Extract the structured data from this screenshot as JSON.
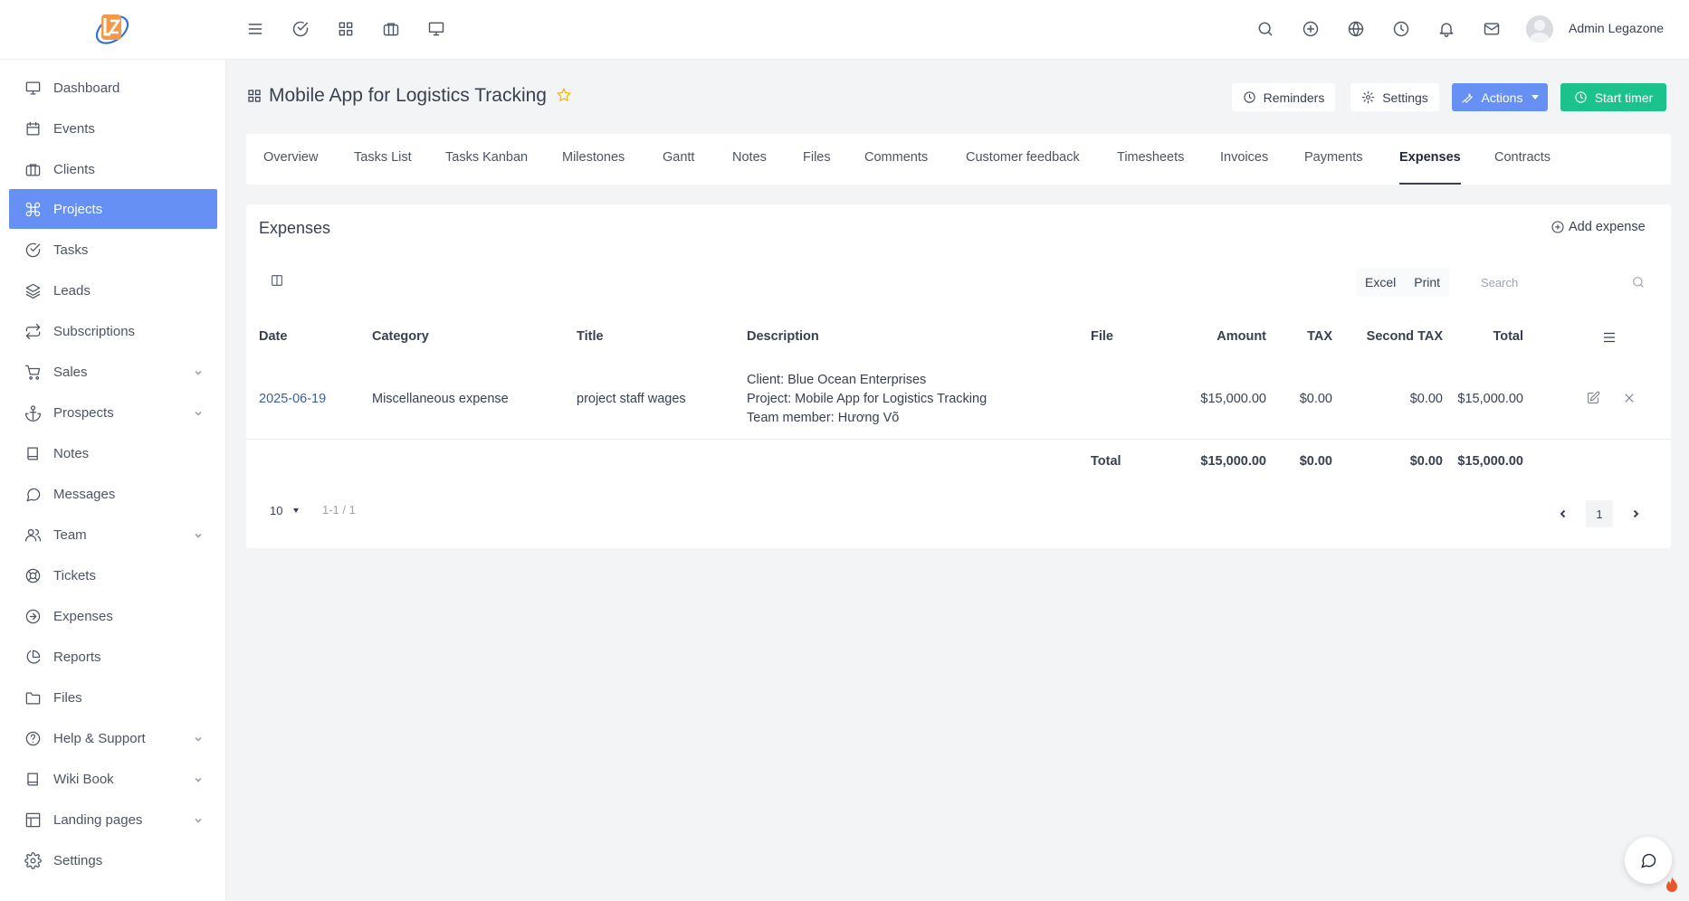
{
  "header": {
    "user_name": "Admin Legazone",
    "left_icons": [
      "menu-icon",
      "check-circle-icon",
      "grid-icon",
      "briefcase-icon",
      "monitor-icon"
    ],
    "right_icons": [
      "search-icon",
      "plus-circle-icon",
      "globe-icon",
      "clock-icon",
      "bell-icon",
      "mail-icon"
    ]
  },
  "sidebar": {
    "items": [
      {
        "label": "Dashboard",
        "icon": "monitor-icon"
      },
      {
        "label": "Events",
        "icon": "calendar-icon"
      },
      {
        "label": "Clients",
        "icon": "briefcase-icon"
      },
      {
        "label": "Projects",
        "icon": "command-icon",
        "active": true
      },
      {
        "label": "Tasks",
        "icon": "check-circle-icon"
      },
      {
        "label": "Leads",
        "icon": "layers-icon"
      },
      {
        "label": "Subscriptions",
        "icon": "repeat-icon"
      },
      {
        "label": "Sales",
        "icon": "cart-icon",
        "has_submenu": true
      },
      {
        "label": "Prospects",
        "icon": "anchor-icon",
        "has_submenu": true
      },
      {
        "label": "Notes",
        "icon": "book-icon"
      },
      {
        "label": "Messages",
        "icon": "message-icon"
      },
      {
        "label": "Team",
        "icon": "users-icon",
        "has_submenu": true
      },
      {
        "label": "Tickets",
        "icon": "life-buoy-icon"
      },
      {
        "label": "Expenses",
        "icon": "arrow-right-circle-icon"
      },
      {
        "label": "Reports",
        "icon": "pie-chart-icon"
      },
      {
        "label": "Files",
        "icon": "folder-icon"
      },
      {
        "label": "Help & Support",
        "icon": "help-circle-icon",
        "has_submenu": true
      },
      {
        "label": "Wiki Book",
        "icon": "book-open-icon",
        "has_submenu": true
      },
      {
        "label": "Landing pages",
        "icon": "layout-icon",
        "has_submenu": true
      },
      {
        "label": "Settings",
        "icon": "settings-icon"
      }
    ]
  },
  "page": {
    "title": "Mobile App for Logistics Tracking",
    "buttons": {
      "reminders": "Reminders",
      "settings": "Settings",
      "actions": "Actions",
      "start_timer": "Start timer"
    }
  },
  "tabs": [
    {
      "label": "Overview"
    },
    {
      "label": "Tasks List"
    },
    {
      "label": "Tasks Kanban"
    },
    {
      "label": "Milestones"
    },
    {
      "label": "Gantt"
    },
    {
      "label": "Notes"
    },
    {
      "label": "Files"
    },
    {
      "label": "Comments"
    },
    {
      "label": "Customer feedback"
    },
    {
      "label": "Timesheets"
    },
    {
      "label": "Invoices"
    },
    {
      "label": "Payments"
    },
    {
      "label": "Expenses",
      "active": true
    },
    {
      "label": "Contracts"
    }
  ],
  "expenses": {
    "title": "Expenses",
    "add_label": "Add expense",
    "export": {
      "excel": "Excel",
      "print": "Print"
    },
    "search_placeholder": "Search",
    "columns": {
      "date": "Date",
      "category": "Category",
      "title": "Title",
      "description": "Description",
      "file": "File",
      "amount": "Amount",
      "tax": "TAX",
      "second_tax": "Second TAX",
      "total": "Total"
    },
    "rows": [
      {
        "date": "2025-06-19",
        "category": "Miscellaneous expense",
        "title": "project staff wages",
        "description": [
          "Client: Blue Ocean Enterprises",
          "Project: Mobile App for Logistics Tracking",
          "Team member: Hương Võ"
        ],
        "file": "",
        "amount": "$15,000.00",
        "tax": "$0.00",
        "second_tax": "$0.00",
        "total": "$15,000.00"
      }
    ],
    "totals": {
      "label": "Total",
      "amount": "$15,000.00",
      "tax": "$0.00",
      "second_tax": "$0.00",
      "total": "$15,000.00"
    },
    "pagination": {
      "page_size": "10",
      "info": "1-1 / 1",
      "current_page": "1"
    }
  },
  "colors": {
    "primary": "#6690f4",
    "success": "#1cc28c",
    "star": "#f5b301",
    "link": "#3b5f9c"
  }
}
